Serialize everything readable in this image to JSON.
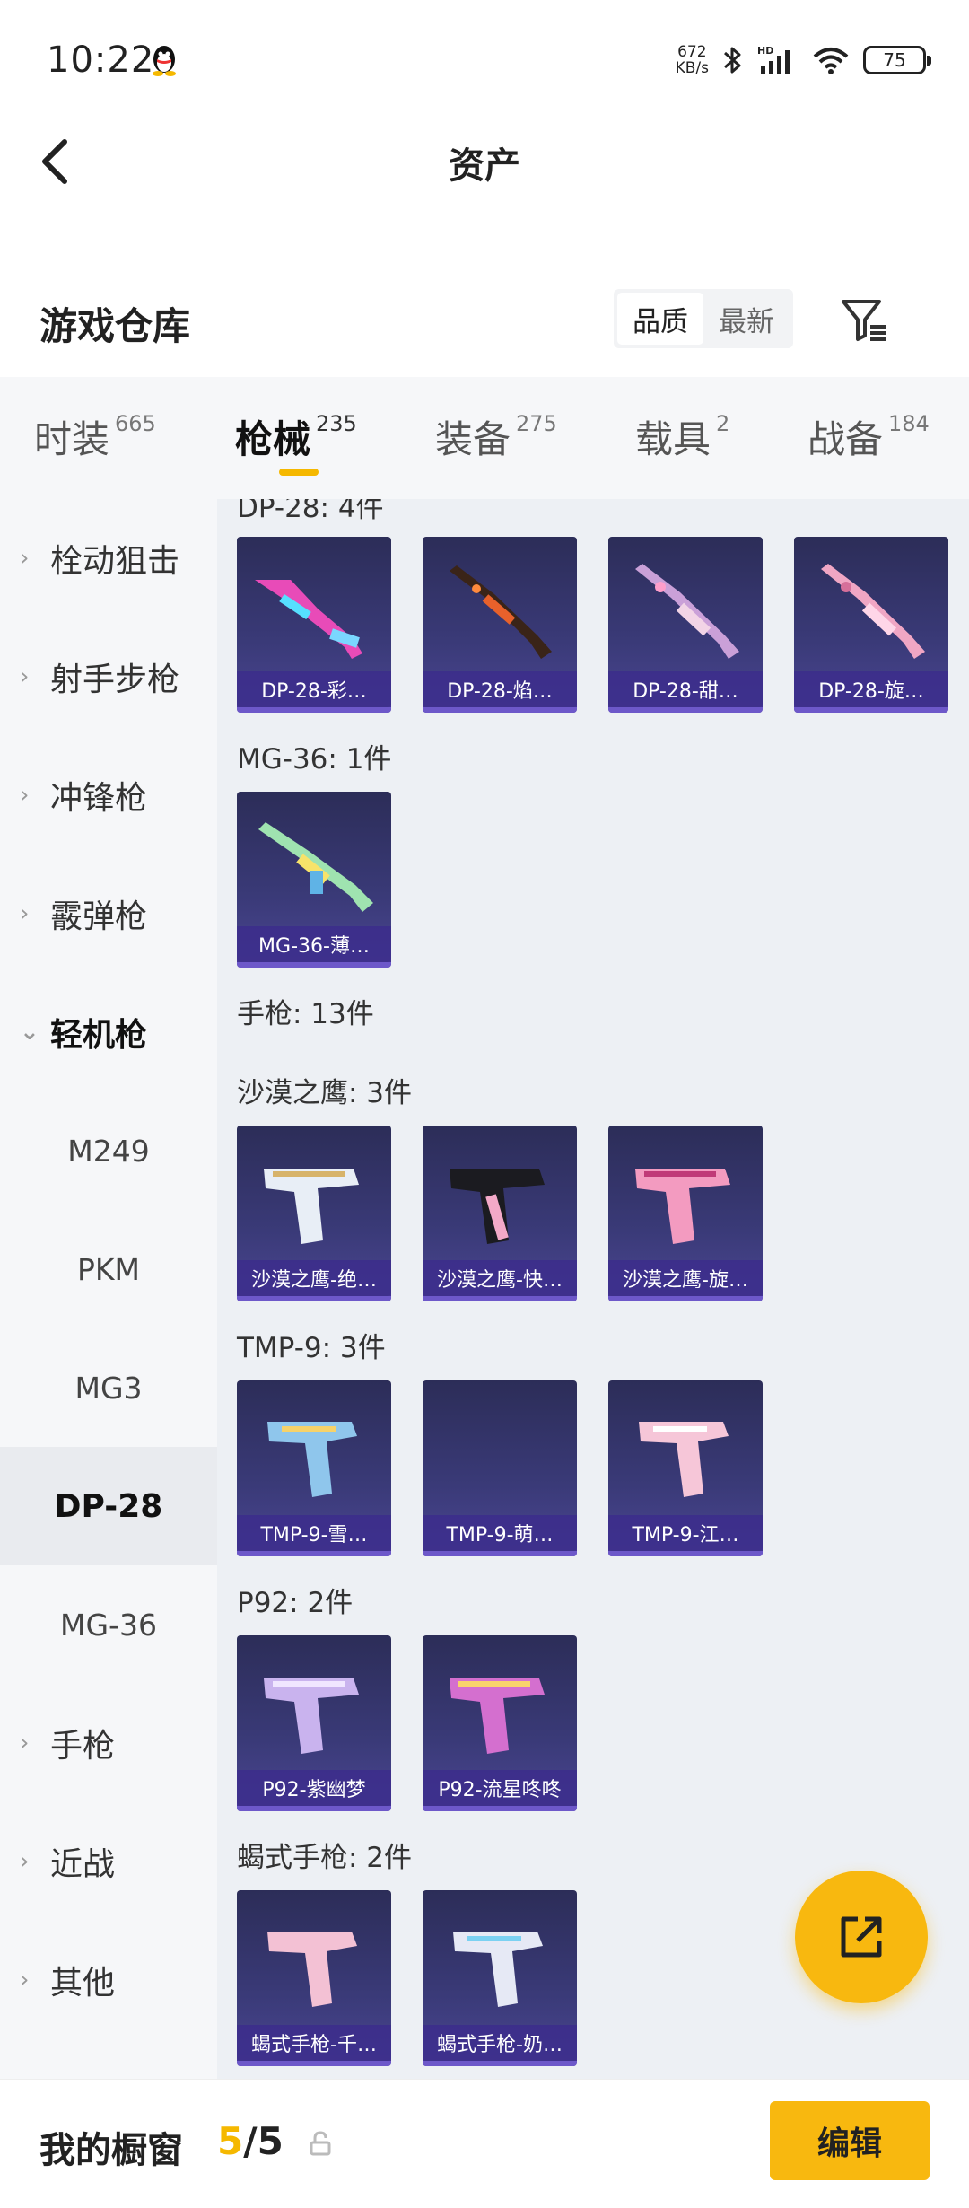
{
  "status_bar": {
    "time": "10:22",
    "net_speed_value": "672",
    "net_speed_unit": "KB/s",
    "battery": "75",
    "icons": [
      "qq-penguin-icon",
      "bluetooth-icon",
      "hd-signal-icon",
      "wifi-icon",
      "battery-icon"
    ]
  },
  "nav": {
    "title": "资产",
    "back_icon": "chevron-left-icon"
  },
  "header": {
    "title": "游戏仓库",
    "sort_options": [
      "品质",
      "最新"
    ],
    "sort_selected": "品质",
    "filter_icon": "filter-icon"
  },
  "tabs": [
    {
      "label": "时装",
      "count": "665"
    },
    {
      "label": "枪械",
      "count": "235",
      "active": true
    },
    {
      "label": "装备",
      "count": "275"
    },
    {
      "label": "载具",
      "count": "2"
    },
    {
      "label": "战备",
      "count": "184"
    }
  ],
  "sidebar": {
    "items": [
      {
        "label": "栓动狙击",
        "chev": "›"
      },
      {
        "label": "射手步枪",
        "chev": "›"
      },
      {
        "label": "冲锋枪",
        "chev": "›"
      },
      {
        "label": "霰弹枪",
        "chev": "›"
      },
      {
        "label": "轻机枪",
        "chev": "⌄",
        "expanded": true
      }
    ],
    "sub_items": [
      {
        "label": "M249"
      },
      {
        "label": "PKM"
      },
      {
        "label": "MG3"
      },
      {
        "label": "DP-28",
        "selected": true
      },
      {
        "label": "MG-36"
      }
    ],
    "items_after": [
      {
        "label": "手枪",
        "chev": "›"
      },
      {
        "label": "近战",
        "chev": "›"
      },
      {
        "label": "其他",
        "chev": "›"
      }
    ]
  },
  "content": {
    "groups": [
      {
        "title": "DP-28: 4件",
        "cards": [
          "DP-28-彩…",
          "DP-28-焰…",
          "DP-28-甜…",
          "DP-28-旋…"
        ]
      },
      {
        "title": "MG-36: 1件",
        "cards": [
          "MG-36-薄…"
        ]
      },
      {
        "title": "手枪: 13件",
        "cards": []
      },
      {
        "title": "沙漠之鹰: 3件",
        "cards": [
          "沙漠之鹰-绝…",
          "沙漠之鹰-快…",
          "沙漠之鹰-旋…"
        ]
      },
      {
        "title": "TMP-9: 3件",
        "cards": [
          "TMP-9-雪…",
          "TMP-9-萌…",
          "TMP-9-江…"
        ]
      },
      {
        "title": "P92: 2件",
        "cards": [
          "P92-紫幽梦",
          "P92-流星咚咚"
        ]
      },
      {
        "title": "蝎式手枪: 2件",
        "cards": [
          "蝎式手枪-千…",
          "蝎式手枪-奶…"
        ]
      }
    ]
  },
  "fab": {
    "icon": "share-external-icon"
  },
  "bottom": {
    "label": "我的橱窗",
    "current": "5",
    "total": "/5",
    "lock_icon": "lock-icon",
    "edit_label": "编辑"
  },
  "colors": {
    "accent": "#f8b80f",
    "card_bg": "#3a3a78",
    "card_label_bg": "#3c2d8c",
    "sidebar_bg": "#f6f7f9",
    "content_bg": "#edf0f4"
  }
}
